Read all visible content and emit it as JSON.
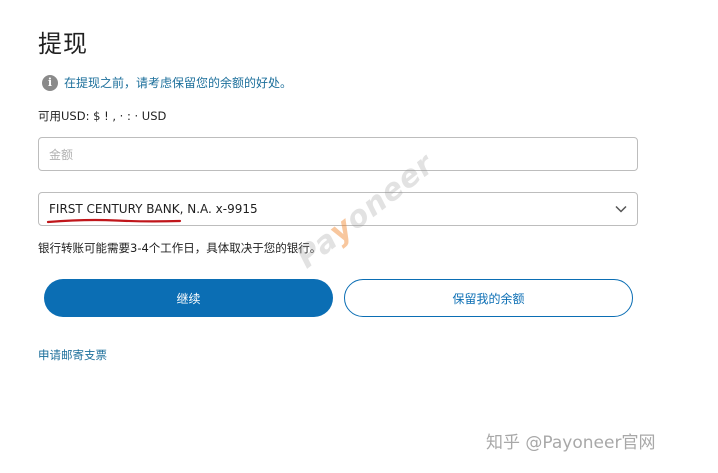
{
  "page": {
    "title": "提现"
  },
  "info": {
    "icon": "info-icon",
    "text": "在提现之前，请考虑保留您的余额的好处。"
  },
  "balance": {
    "text": "可用USD: $ ! ,  ·  : · USD"
  },
  "amount_input": {
    "value": "",
    "placeholder": "金额"
  },
  "bank_select": {
    "value": "FIRST CENTURY BANK, N.A. x-9915",
    "icon": "chevron-down-icon"
  },
  "transfer_note": "银行转账可能需要3-4个工作日，具体取决于您的银行。",
  "buttons": {
    "continue": "继续",
    "keep_balance": "保留我的余额"
  },
  "links": {
    "mail_check": "申请邮寄支票"
  },
  "watermark": {
    "logo": "Payoneer",
    "footer": "知乎 @Payoneer官网"
  },
  "colors": {
    "primary": "#0b6eb4",
    "link": "#1c6f9b",
    "annotation": "#c0161b"
  }
}
